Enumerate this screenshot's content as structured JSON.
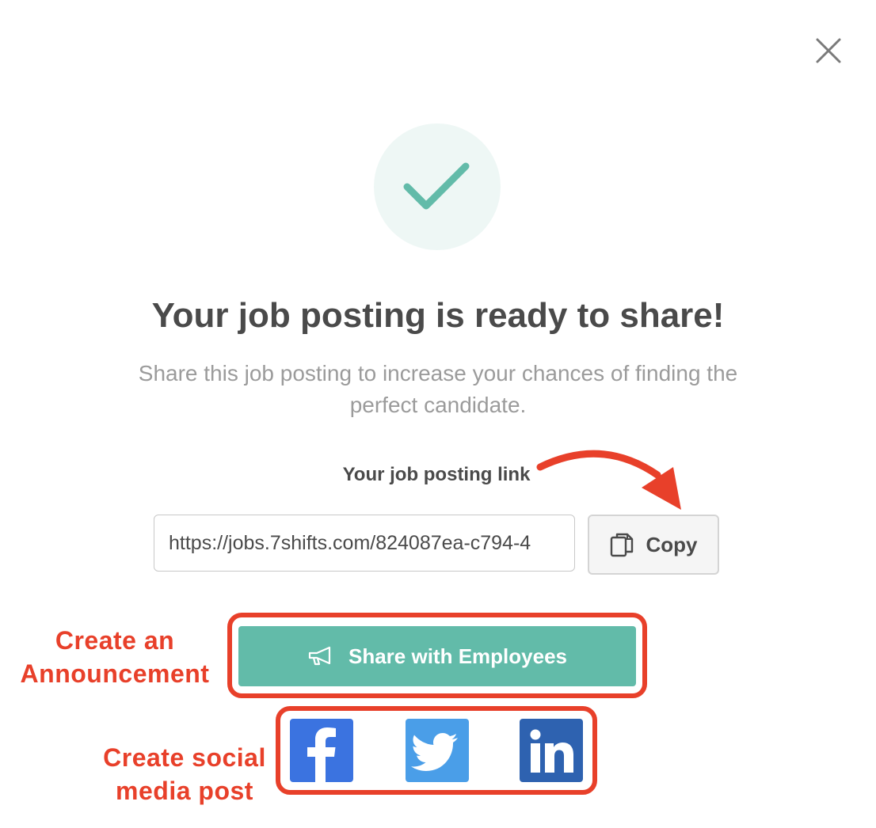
{
  "dialog": {
    "close_icon": "close-icon",
    "success_icon": "check-icon",
    "title": "Your job posting is ready to share!",
    "subtitle": "Share this job posting to increase your chances of finding the perfect candidate.",
    "link_label": "Your job posting link",
    "link_value": "https://jobs.7shifts.com/824087ea-c794-4",
    "copy_label": "Copy",
    "share_label": "Share with Employees"
  },
  "social": {
    "facebook": "facebook-icon",
    "twitter": "twitter-icon",
    "linkedin": "linkedin-icon"
  },
  "annotations": {
    "announcement_line1": "Create an",
    "announcement_line2": "Announcement",
    "social_line1": "Create social",
    "social_line2": "media post"
  },
  "colors": {
    "primary": "#62bba9",
    "annotation_red": "#e8402a",
    "facebook": "#3b73e0",
    "twitter": "#4a9ee8",
    "linkedin": "#2e62b0"
  }
}
